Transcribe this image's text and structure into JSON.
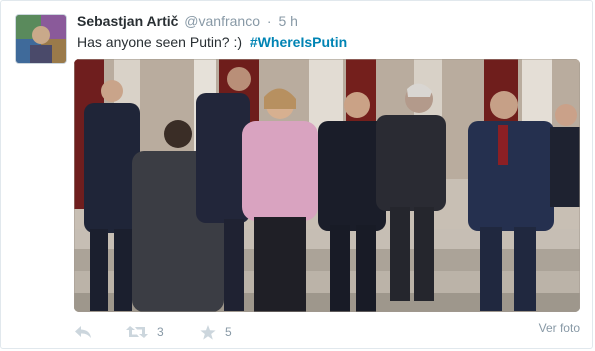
{
  "tweet": {
    "author_name": "Sebastjan Artič",
    "author_handle": "@vanfranco",
    "separator": "·",
    "time": "5 h",
    "text": "Has anyone seen Putin? :)",
    "hashtag": "#WhereIsPutin"
  },
  "photo": {
    "icon": "photo-of-people-looking-down"
  },
  "actions": {
    "reply_icon": "reply-icon",
    "retweet_icon": "retweet-icon",
    "retweet_count": "3",
    "favorite_icon": "star-icon",
    "favorite_count": "5",
    "view_photo_label": "Ver foto"
  },
  "colors": {
    "link": "#0084b4",
    "muted": "#8899a6",
    "text": "#292f33",
    "icon": "#ccd6dd"
  }
}
